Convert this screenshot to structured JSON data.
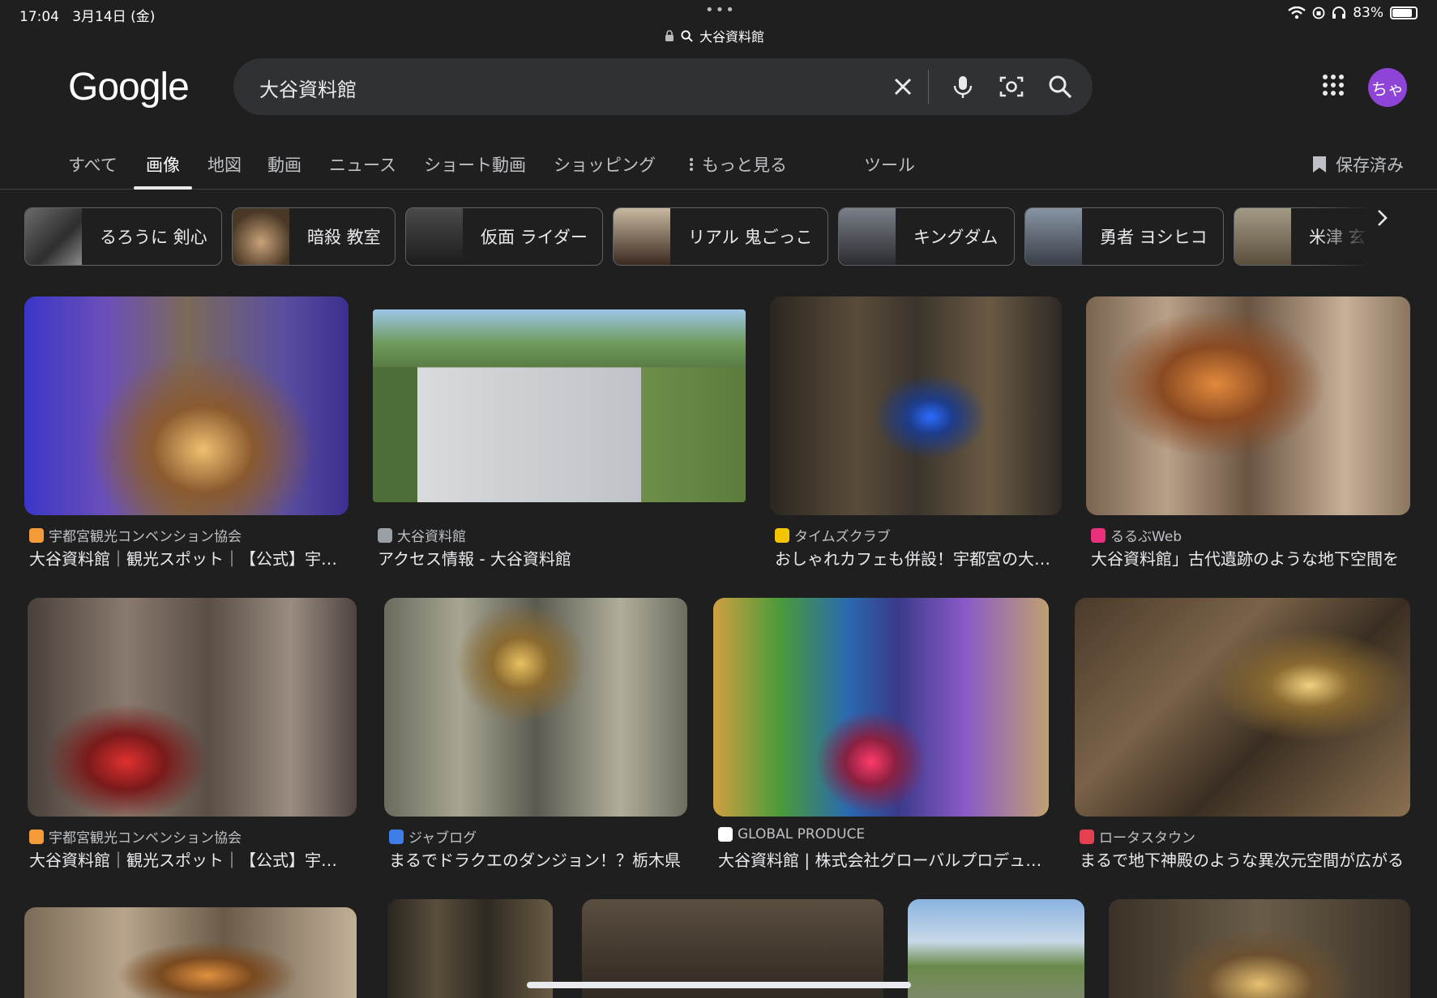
{
  "status_bar": {
    "time": "17:04",
    "date": "3月14日 (金)",
    "url": "大谷資料館",
    "battery": "83%",
    "dots": "•••"
  },
  "logo": "Google",
  "search": {
    "query": "大谷資料館"
  },
  "avatar": "ちゃ",
  "tabs": [
    {
      "label": "すべて"
    },
    {
      "label": "画像"
    },
    {
      "label": "地図"
    },
    {
      "label": "動画"
    },
    {
      "label": "ニュース"
    },
    {
      "label": "ショート動画"
    },
    {
      "label": "ショッピング"
    },
    {
      "label": "もっと見る"
    },
    {
      "label": "ツール"
    }
  ],
  "saved_label": "保存済み",
  "chips": [
    {
      "label": "るろうに 剣心"
    },
    {
      "label": "暗殺 教室"
    },
    {
      "label": "仮面 ライダー"
    },
    {
      "label": "リアル 鬼ごっこ"
    },
    {
      "label": "キングダム"
    },
    {
      "label": "勇者 ヨシヒコ"
    },
    {
      "label": "米津 玄"
    }
  ],
  "results": [
    {
      "source": "宇都宮観光コンベンション協会",
      "title": "大谷資料館｜観光スポット｜【公式】宇都宮観光",
      "favicon": "#f29b38"
    },
    {
      "source": "大谷資料館",
      "title": "アクセス情報 - 大谷資料館",
      "favicon": "#9aa0a6"
    },
    {
      "source": "タイムズクラブ",
      "title": "おしゃれカフェも併設！宇都宮の大谷資料館",
      "favicon": "#f5c400"
    },
    {
      "source": "るるぶWeb",
      "title": "大谷資料館」古代遺跡のような地下空間を",
      "favicon": "#e8317a"
    },
    {
      "source": "宇都宮観光コンベンション協会",
      "title": "大谷資料館｜観光スポット｜【公式】宇都宮観光",
      "favicon": "#f29b38"
    },
    {
      "source": "ジャブログ",
      "title": "まるでドラクエのダンジョン！？栃木県",
      "favicon": "#3f7ee8"
    },
    {
      "source": "GLOBAL PRODUCE",
      "title": "大谷資料館 | 株式会社グローバルプロデュース",
      "favicon": "#ffffff"
    },
    {
      "source": "ロータスタウン",
      "title": "まるで地下神殿のような異次元空間が広がる",
      "favicon": "#e34050"
    }
  ]
}
